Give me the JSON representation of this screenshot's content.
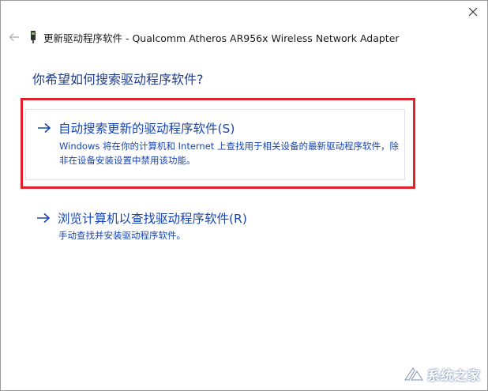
{
  "window": {
    "close_icon": "close-icon"
  },
  "header": {
    "back_icon": "back-arrow-icon",
    "device_icon": "network-adapter-icon",
    "title": "更新驱动程序软件 - Qualcomm Atheros AR956x Wireless Network Adapter"
  },
  "main": {
    "question": "你希望如何搜索驱动程序软件?",
    "options": [
      {
        "icon": "right-arrow-icon",
        "title": "自动搜索更新的驱动程序软件(S)",
        "description": "Windows 将在你的计算机和 Internet 上查找用于相关设备的最新驱动程序软件，除非在设备安装设置中禁用该功能。"
      },
      {
        "icon": "right-arrow-icon",
        "title": "浏览计算机以查找驱动程序软件(R)",
        "description": "手动查找并安装驱动程序软件。"
      }
    ]
  },
  "annotation": {
    "highlight_color": "#e0202a"
  },
  "watermark": {
    "text": "系统之家"
  },
  "colors": {
    "link_blue": "#1746b3",
    "heading_blue": "#1e3c8a"
  }
}
